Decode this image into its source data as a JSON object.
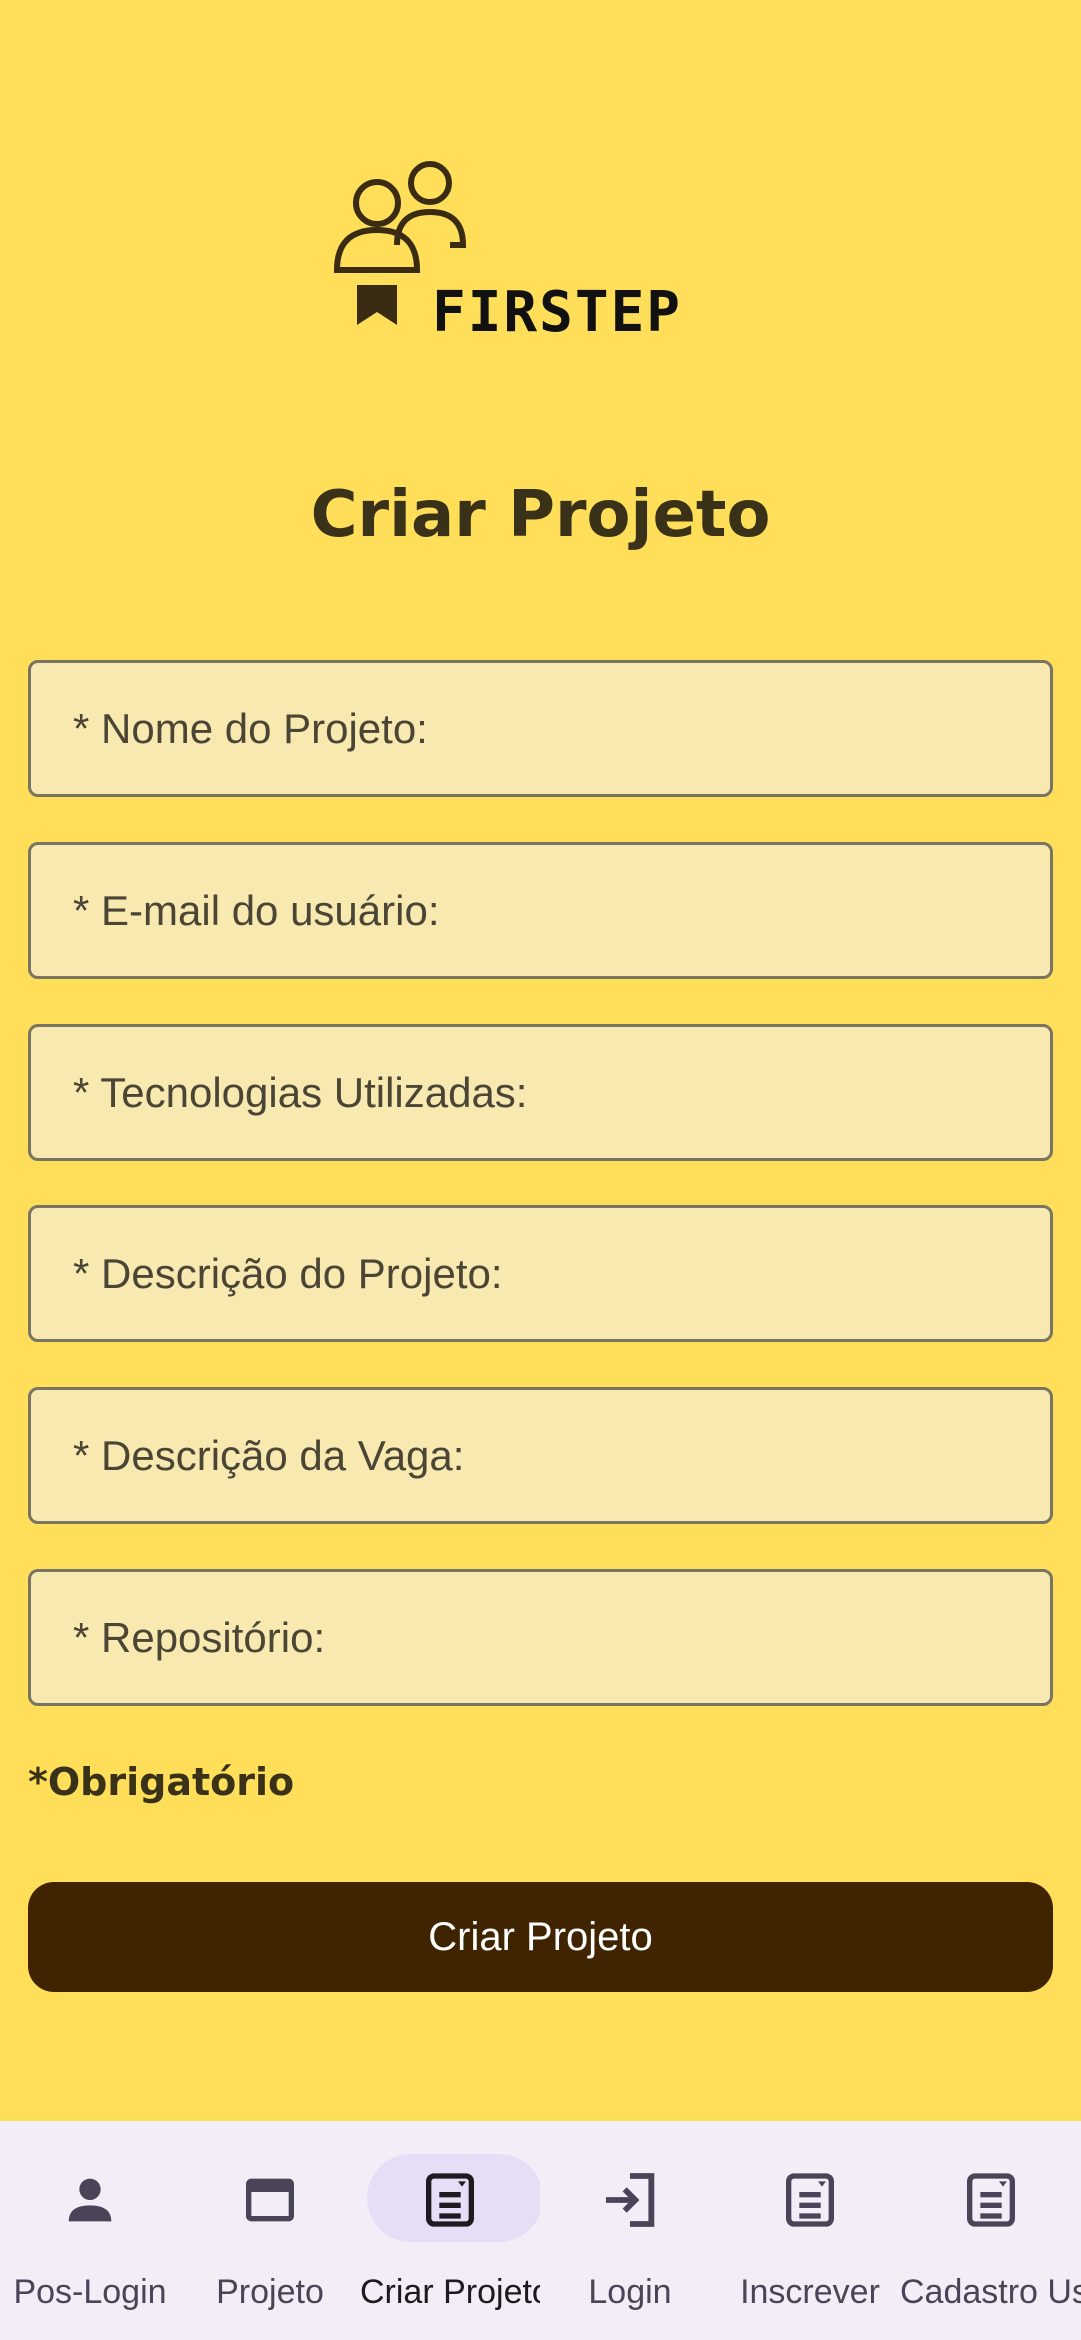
{
  "logo": {
    "text": "FIRSTEP"
  },
  "page": {
    "title": "Criar Projeto"
  },
  "form": {
    "fields": [
      {
        "placeholder": "* Nome do Projeto:"
      },
      {
        "placeholder": "* E-mail do usuário:"
      },
      {
        "placeholder": "* Tecnologias Utilizadas:"
      },
      {
        "placeholder": "* Descrição do Projeto:"
      },
      {
        "placeholder": "* Descrição da Vaga:"
      },
      {
        "placeholder": "* Repositório:"
      }
    ],
    "required_note": "*Obrigatório",
    "submit_label": "Criar Projeto"
  },
  "navbar": {
    "items": [
      {
        "label": "Pos-Login",
        "icon": "person-icon"
      },
      {
        "label": "Projeto",
        "icon": "window-icon"
      },
      {
        "label": "Criar Projeto",
        "icon": "document-icon",
        "active": true
      },
      {
        "label": "Login",
        "icon": "login-icon"
      },
      {
        "label": "Inscrever",
        "icon": "document-icon"
      },
      {
        "label": "Cadastro Usuário",
        "icon": "document-icon"
      }
    ]
  },
  "colors": {
    "background": "#FFDE59",
    "field_bg": "#F7E9AF",
    "button_bg": "#402400",
    "nav_bg": "#F2EDF6",
    "nav_active_pill": "#E6DDF6"
  }
}
